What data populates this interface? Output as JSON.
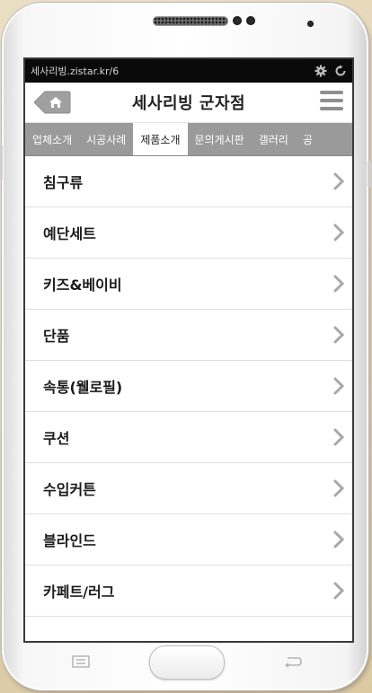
{
  "status": {
    "url": "세사리빙.zistar.kr/6"
  },
  "header": {
    "title": "세사리빙 군자점"
  },
  "tabs": [
    {
      "label": "업체소개",
      "active": false
    },
    {
      "label": "시공사례",
      "active": false
    },
    {
      "label": "제품소개",
      "active": true
    },
    {
      "label": "문의게시판",
      "active": false
    },
    {
      "label": "갤러리",
      "active": false
    },
    {
      "label": "공",
      "active": false
    }
  ],
  "menu": [
    {
      "label": "침구류"
    },
    {
      "label": "예단세트"
    },
    {
      "label": "키즈&베이비"
    },
    {
      "label": "단품"
    },
    {
      "label": "속통(웰로필)"
    },
    {
      "label": "쿠션"
    },
    {
      "label": "수입커튼"
    },
    {
      "label": "블라인드"
    },
    {
      "label": "카페트/러그"
    }
  ],
  "colors": {
    "tab_bar": "#9a9a9a",
    "status_bar": "#0a0a0a",
    "background": "#e9dcc0"
  },
  "icons": {
    "home": "home-icon",
    "menu": "hamburger-icon",
    "chevron": "chevron-right-icon",
    "settings": "gear-icon",
    "refresh": "refresh-icon"
  }
}
